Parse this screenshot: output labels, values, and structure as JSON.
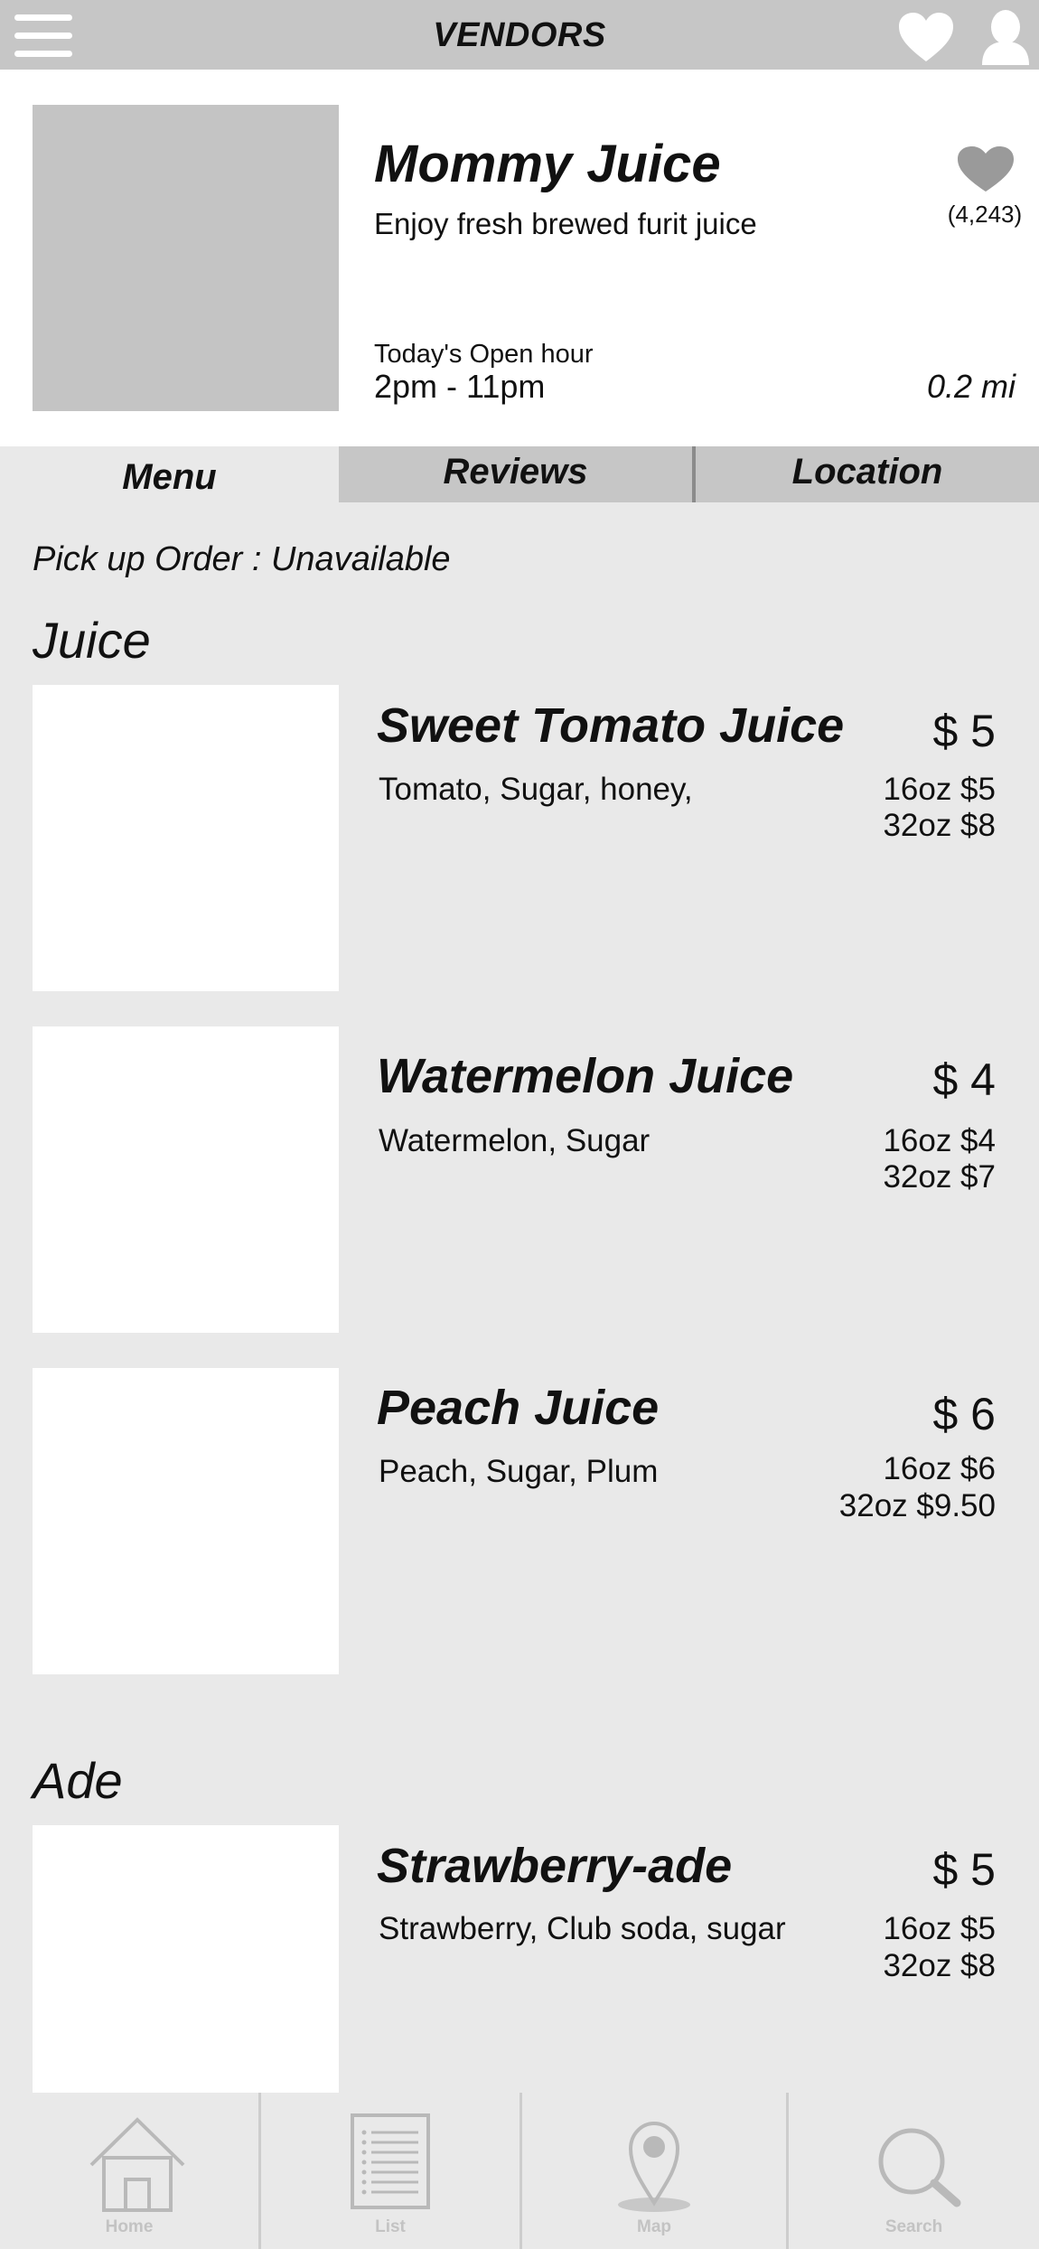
{
  "header": {
    "title": "VENDORS"
  },
  "vendor": {
    "name": "Mommy Juice",
    "tagline": "Enjoy fresh brewed furit juice",
    "favorites_count": "(4,243)",
    "open_label": "Today's Open hour",
    "open_hours": "2pm - 11pm",
    "distance": "0.2 mi"
  },
  "tabs": [
    {
      "label": "Menu",
      "active": true
    },
    {
      "label": "Reviews",
      "active": false
    },
    {
      "label": "Location",
      "active": false
    }
  ],
  "pickup_status": "Pick up Order : Unavailable",
  "sections": [
    {
      "title": "Juice",
      "items": [
        {
          "name": "Sweet Tomato Juice",
          "ingredients": "Tomato, Sugar, honey,",
          "price": "$ 5",
          "sizes": [
            "16oz $5",
            "32oz $8"
          ]
        },
        {
          "name": "Watermelon Juice",
          "ingredients": "Watermelon, Sugar",
          "price": "$ 4",
          "sizes": [
            "16oz $4",
            "32oz $7"
          ]
        },
        {
          "name": "Peach Juice",
          "ingredients": "Peach, Sugar, Plum",
          "price": "$ 6",
          "sizes": [
            "16oz $6",
            "32oz $9.50"
          ]
        }
      ]
    },
    {
      "title": "Ade",
      "items": [
        {
          "name": "Strawberry-ade",
          "ingredients": "Strawberry, Club soda, sugar",
          "price": "$ 5",
          "sizes": [
            "16oz $5",
            "32oz $8"
          ]
        }
      ]
    }
  ],
  "bottom_nav": [
    {
      "label": "Home",
      "icon": "home-icon"
    },
    {
      "label": "List",
      "icon": "list-icon"
    },
    {
      "label": "Map",
      "icon": "map-pin-icon"
    },
    {
      "label": "Search",
      "icon": "search-icon"
    }
  ],
  "colors": {
    "bar_gray": "#c6c6c6",
    "background": "#e9e9e9",
    "placeholder_gray": "#c4c4c4",
    "icon_gray": "#b7b7b7"
  }
}
